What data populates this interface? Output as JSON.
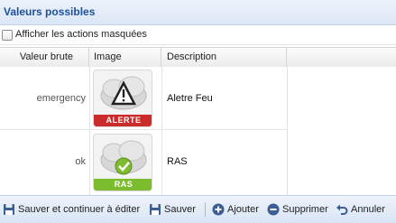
{
  "panel": {
    "title": "Valeurs possibles"
  },
  "filter": {
    "show_hidden_label": "Afficher les actions masquées",
    "checked": false
  },
  "grid": {
    "columns": [
      "Valeur brute",
      "Image",
      "Description",
      ""
    ],
    "rows": [
      {
        "value": "emergency",
        "badge": "ALERTE",
        "badge_color": "#cc2b2b",
        "icon": "warning-icon",
        "description": "Aletre Feu"
      },
      {
        "value": "ok",
        "badge": "RAS",
        "badge_color": "#7dbb2f",
        "icon": "check-icon",
        "description": "RAS"
      }
    ]
  },
  "toolbar": {
    "save_continue": "Sauver et continuer à éditer",
    "save": "Sauver",
    "add": "Ajouter",
    "delete": "Supprimer",
    "cancel": "Annuler"
  }
}
